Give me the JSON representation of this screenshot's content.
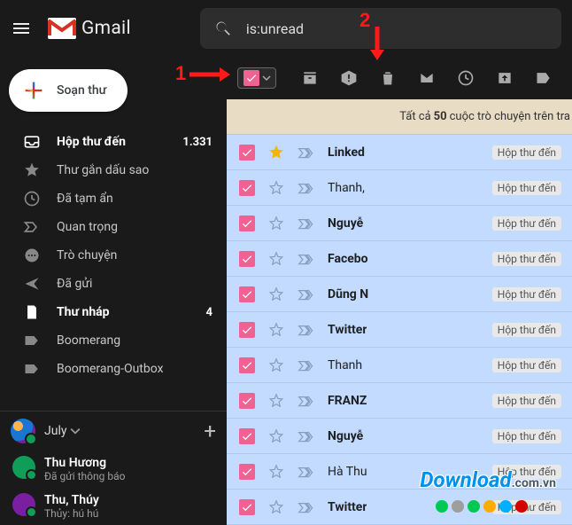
{
  "app_name": "Gmail",
  "search": {
    "query": "is:unread"
  },
  "compose_label": "Soạn thư",
  "sidebar": {
    "items": [
      {
        "label": "Hộp thư đến",
        "count": "1.331",
        "icon": "inbox",
        "bold": true
      },
      {
        "label": "Thư gắn dấu sao",
        "count": "",
        "icon": "star",
        "bold": false
      },
      {
        "label": "Đã tạm ẩn",
        "count": "",
        "icon": "clock",
        "bold": false
      },
      {
        "label": "Quan trọng",
        "count": "",
        "icon": "imp",
        "bold": false
      },
      {
        "label": "Trò chuyện",
        "count": "",
        "icon": "chat",
        "bold": false
      },
      {
        "label": "Đã gửi",
        "count": "",
        "icon": "sent",
        "bold": false
      },
      {
        "label": "Thư nháp",
        "count": "4",
        "icon": "draft",
        "bold": true
      },
      {
        "label": "Boomerang",
        "count": "",
        "icon": "label",
        "bold": false
      },
      {
        "label": "Boomerang-Outbox",
        "count": "",
        "icon": "label",
        "bold": false
      }
    ]
  },
  "hangouts": {
    "me": "July",
    "chats": [
      {
        "name": "Thu Hương",
        "sub": "Đã gửi thông báo"
      },
      {
        "name": "Thu, Thúy",
        "sub": "Thủy: hú hú"
      }
    ]
  },
  "banner": {
    "prefix": "Tất cả ",
    "count": "50",
    "suffix": " cuộc trò chuyện trên tra"
  },
  "label_tag": "Hộp thư đến",
  "rows": [
    {
      "from": "Linked",
      "starred": true,
      "bold": true
    },
    {
      "from": "Thanh,",
      "starred": false,
      "bold": false
    },
    {
      "from": "Nguyễ",
      "starred": false,
      "bold": true
    },
    {
      "from": "Facebo",
      "starred": false,
      "bold": true
    },
    {
      "from": "Dũng N",
      "starred": false,
      "bold": true
    },
    {
      "from": "Twitter",
      "starred": false,
      "bold": true
    },
    {
      "from": "Thanh",
      "starred": false,
      "bold": false
    },
    {
      "from": "FRANZ",
      "starred": false,
      "bold": true
    },
    {
      "from": "Nguyễ",
      "starred": false,
      "bold": true
    },
    {
      "from": "Hà Thu",
      "starred": false,
      "bold": false
    },
    {
      "from": "Twitter",
      "starred": false,
      "bold": true
    }
  ],
  "annotations": {
    "n1": "1",
    "n2": "2"
  },
  "watermark": {
    "main": "Download",
    "sub": ".com.vn"
  },
  "dot_colors": [
    "#00c853",
    "#9e9e9e",
    "#00c853",
    "#ffab00",
    "#00b0ff",
    "#d50000"
  ]
}
